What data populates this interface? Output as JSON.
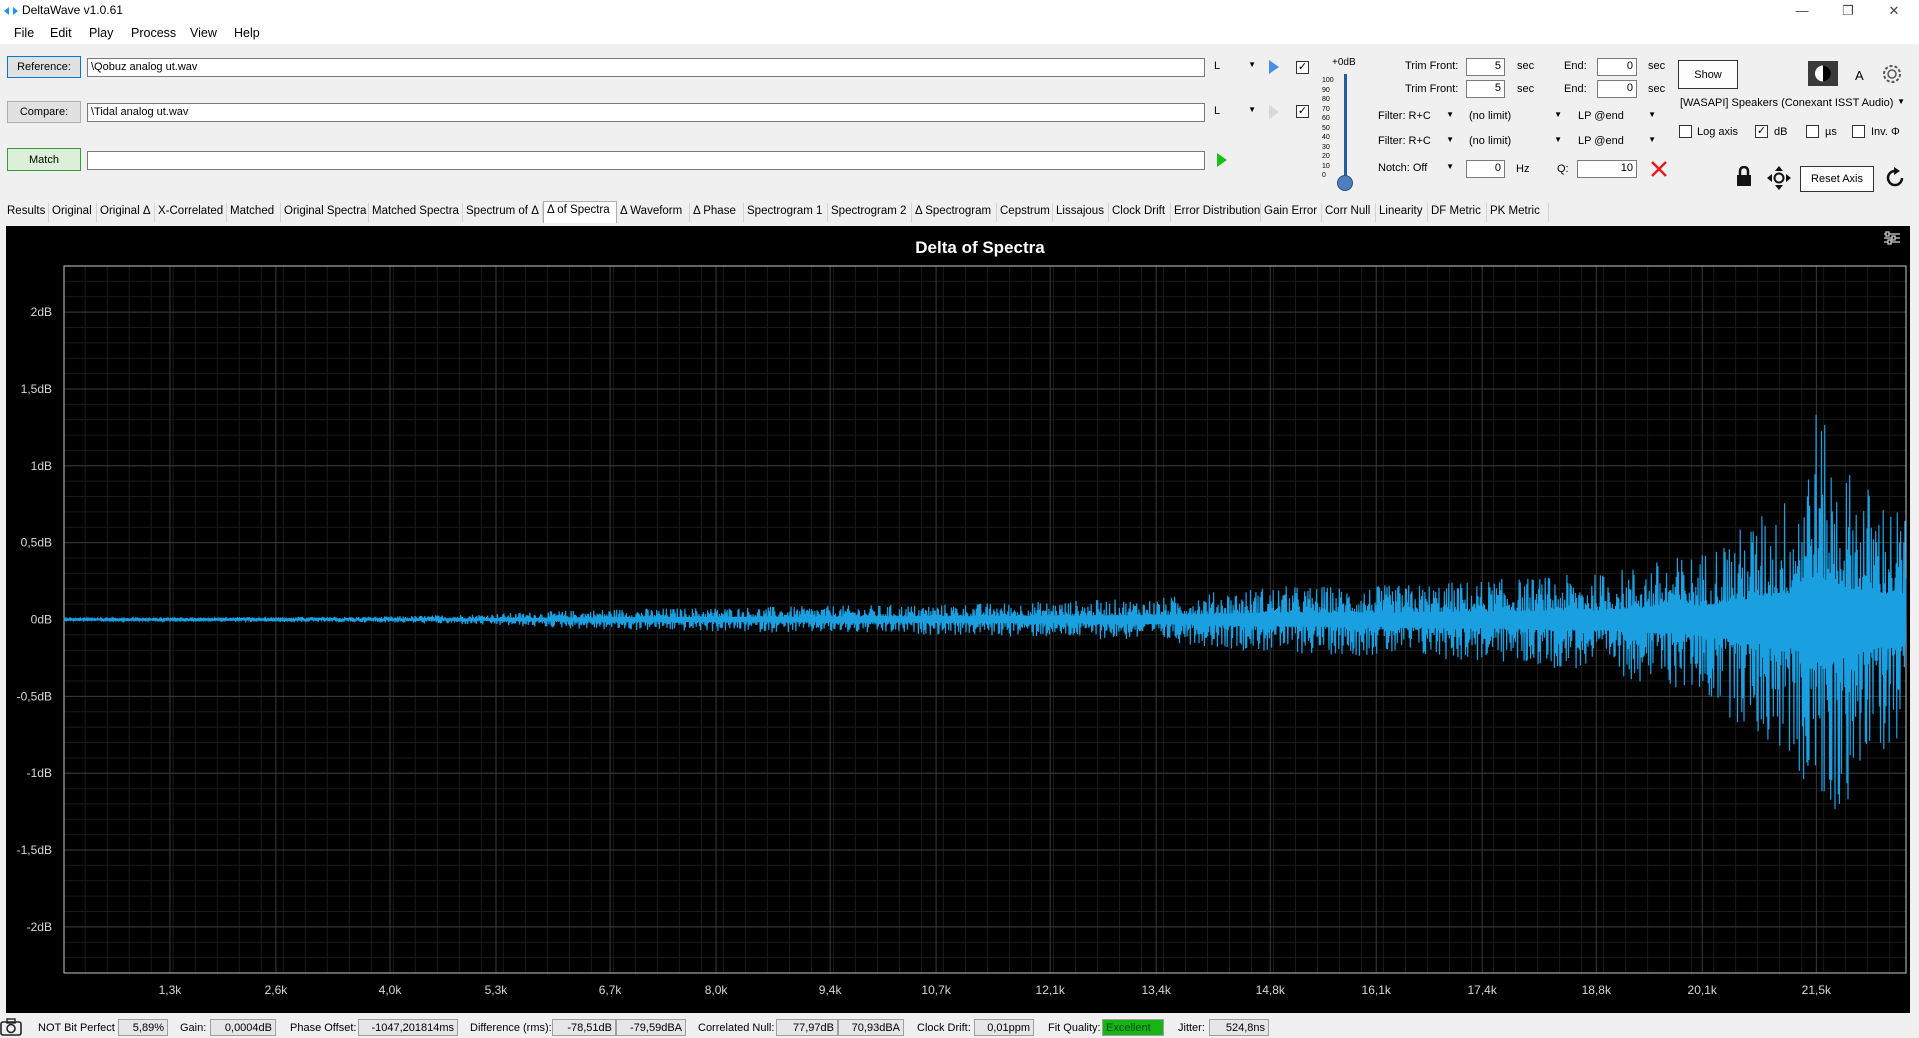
{
  "window": {
    "title": "DeltaWave v1.0.61",
    "accent": "#1e90ff"
  },
  "menu": [
    "File",
    "Edit",
    "Play",
    "Process",
    "View",
    "Help"
  ],
  "reference": {
    "button": "Reference:",
    "path": "\\Qobuz analog ut.wav",
    "channel": "L"
  },
  "compare": {
    "button": "Compare:",
    "path": "\\Tidal analog ut.wav",
    "channel": "L"
  },
  "match": {
    "button": "Match",
    "path": ""
  },
  "level": {
    "label": "+0dB",
    "ticks": [
      "100",
      "90",
      "80",
      "70",
      "60",
      "50",
      "40",
      "30",
      "20",
      "10",
      "0"
    ]
  },
  "trim": {
    "front_label": "Trim Front:",
    "end_label": "End:",
    "sec": "sec",
    "ref_front": "5",
    "ref_end": "0",
    "cmp_front": "5",
    "cmp_end": "0"
  },
  "filters": {
    "filter_label": "Filter: R+C",
    "limit": "(no limit)",
    "lp": "LP @end",
    "notch": "Notch: Off",
    "notch_hz": "0",
    "hz": "Hz",
    "q_label": "Q:",
    "q_value": "10"
  },
  "right": {
    "show_button": "Show",
    "theme_label": "A",
    "device": "[WASAPI] Speakers (Conexant ISST Audio)",
    "log_axis": "Log axis",
    "db": "dB",
    "us": "µs",
    "inv": "Inv. Φ",
    "reset_axis": "Reset Axis"
  },
  "tabs": [
    "Results",
    "Original",
    "Original Δ",
    "X-Correlated",
    "Matched",
    "Original Spectra",
    "Matched Spectra",
    "Spectrum of Δ",
    "Δ of Spectra",
    "Δ Waveform",
    "Δ Phase",
    "Spectrogram 1",
    "Spectrogram 2",
    "Δ Spectrogram",
    "Cepstrum",
    "Lissajous",
    "Clock Drift",
    "Error Distribution",
    "Gain Error",
    "Corr Null",
    "Linearity",
    "DF Metric",
    "PK Metric"
  ],
  "active_tab": "Δ of Spectra",
  "chart_data": {
    "type": "line",
    "title": "Delta of Spectra",
    "series_color": "#1a9fe0",
    "background": "#000000",
    "grid": true,
    "ylim": [
      -2.3,
      2.3
    ],
    "yticks": [
      2,
      1.5,
      1,
      0.5,
      0,
      -0.5,
      -1,
      -1.5,
      -2
    ],
    "ytick_labels": [
      "2dB",
      "1,5dB",
      "1dB",
      "0,5dB",
      "0dB",
      "-0,5dB",
      "-1dB",
      "-1,5dB",
      "-2dB"
    ],
    "xlim": [
      0,
      22600
    ],
    "xticks": [
      1300,
      2600,
      4000,
      5300,
      6700,
      8000,
      9400,
      10700,
      12100,
      13400,
      14800,
      16100,
      17400,
      18800,
      20100,
      21500
    ],
    "xtick_labels": [
      "1,3k",
      "2,6k",
      "4,0k",
      "5,3k",
      "6,7k",
      "8,0k",
      "9,4k",
      "10,7k",
      "12,1k",
      "13,4k",
      "14,8k",
      "16,1k",
      "17,4k",
      "18,8k",
      "20,1k",
      "21,5k"
    ],
    "envelope_x": [
      0,
      4000,
      5300,
      6700,
      8000,
      9400,
      10700,
      12100,
      13400,
      14800,
      16100,
      17400,
      18800,
      20100,
      20700,
      21200,
      21500,
      21700,
      22000,
      22600
    ],
    "envelope_upper": [
      0.01,
      0.02,
      0.04,
      0.07,
      0.08,
      0.09,
      0.1,
      0.12,
      0.14,
      0.22,
      0.22,
      0.26,
      0.3,
      0.45,
      0.65,
      0.85,
      1.45,
      1.1,
      0.95,
      0.7
    ],
    "envelope_lower": [
      -0.01,
      -0.02,
      -0.04,
      -0.07,
      -0.08,
      -0.09,
      -0.1,
      -0.12,
      -0.14,
      -0.22,
      -0.24,
      -0.28,
      -0.34,
      -0.5,
      -0.75,
      -0.95,
      -1.25,
      -1.4,
      -1.05,
      -0.75
    ]
  },
  "status": {
    "bit_perfect_label": "NOT Bit Perfect",
    "bit_perfect_value": "5,89%",
    "gain_label": "Gain:",
    "gain_value": "0,0004dB",
    "phase_label": "Phase Offset:",
    "phase_value": "-1047,201814ms",
    "diff_label": "Difference (rms):",
    "diff_db": "-78,51dB",
    "diff_dba": "-79,59dBA",
    "null_label": "Correlated Null:",
    "null_db": "77,97dB",
    "null_dba": "70,93dBA",
    "drift_label": "Clock Drift:",
    "drift_value": "0,01ppm",
    "fit_label": "Fit Quality:",
    "fit_value": "Excellent",
    "jitter_label": "Jitter:",
    "jitter_value": "524,8ns"
  }
}
